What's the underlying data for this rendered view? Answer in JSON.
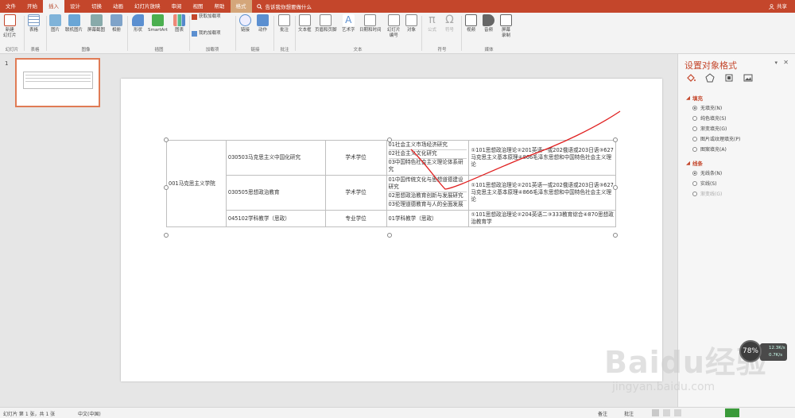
{
  "tabs": {
    "items": [
      "文件",
      "开始",
      "插入",
      "设计",
      "切换",
      "动画",
      "幻灯片放映",
      "审阅",
      "视图",
      "帮助",
      "格式"
    ],
    "active_index": 2,
    "tell_me": "告诉我你想要做什么",
    "share": "共享"
  },
  "ribbon": {
    "new_slide": "新建\n幻灯片",
    "table": "表格",
    "picture": "图片",
    "online_picture": "联机图片",
    "screenshot": "屏幕截图",
    "album": "相册",
    "shapes": "形状",
    "smartart": "SmartArt",
    "chart": "图表",
    "get_addins": "获取加载项",
    "my_addins": "我的加载项",
    "link": "链接",
    "action": "动作",
    "comment": "批注",
    "textbox": "文本框",
    "header_footer": "页眉和页脚",
    "wordart": "艺术字",
    "datetime": "日期和时间",
    "slide_number": "幻灯片\n编号",
    "object": "对象",
    "equation": "公式",
    "symbol": "符号",
    "video": "视频",
    "audio": "音频",
    "screen_record": "屏幕\n录制",
    "groups": {
      "slides": "幻灯片",
      "tables": "表格",
      "images": "图像",
      "illustrations": "插图",
      "addins": "加载项",
      "links": "链接",
      "comments": "批注",
      "text": "文本",
      "symbols": "符号",
      "media": "媒体"
    }
  },
  "thumbnail": {
    "number": "1"
  },
  "table": {
    "college": "001马克思主义学院",
    "rows": [
      {
        "major": "030503马克思主义中国化研究",
        "type": "学术学位",
        "directions": [
          "01社会主义市场经济研究",
          "02社会主义文化研究",
          "03中国特色社会主义理论体系研究"
        ],
        "exams": "①101思想政治理论②201英语一或202俄语或203日语③627马克思主义基本原理④866毛泽东思想和中国特色社会主义理论"
      },
      {
        "major": "030505思想政治教育",
        "type": "学术学位",
        "directions": [
          "01中国传统文化与思想道德建设研究",
          "02思想政治教育创新与发展研究",
          "03伦理道德教育与人的全面发展"
        ],
        "exams": "①101思想政治理论②201英语一或202俄语或203日语③627马克思主义基本原理④866毛泽东思想和中国特色社会主义理论"
      },
      {
        "major": "045102学科教学（思政）",
        "type": "专业学位",
        "directions": [
          "01学科教学（思政）"
        ],
        "exams": "①101思想政治理论②204英语二③333教育综合④870思想政治教育学"
      }
    ]
  },
  "format_pane": {
    "title": "设置对象格式",
    "fill_heading": "填充",
    "fill_options": [
      "无填充(N)",
      "纯色填充(S)",
      "渐变填充(G)",
      "图片或纹理填充(P)",
      "图案填充(A)"
    ],
    "fill_selected": 0,
    "line_heading": "线条",
    "line_options": [
      "无线条(N)",
      "实线(S)",
      "渐变线(G)"
    ],
    "line_selected": 0
  },
  "status": {
    "slide_info": "幻灯片 第 1 张，共 1 张",
    "language": "中文(中国)",
    "notes": "备注",
    "comments": "批注"
  },
  "speed_widget": {
    "percent": "78%",
    "up": "12.3K/s",
    "down": "0.7K/s"
  },
  "watermark": {
    "line1": "Baidu经验",
    "line2": "jingyan.baidu.com"
  },
  "colors": {
    "accent": "#c4462b",
    "annotation": "#e02020"
  }
}
